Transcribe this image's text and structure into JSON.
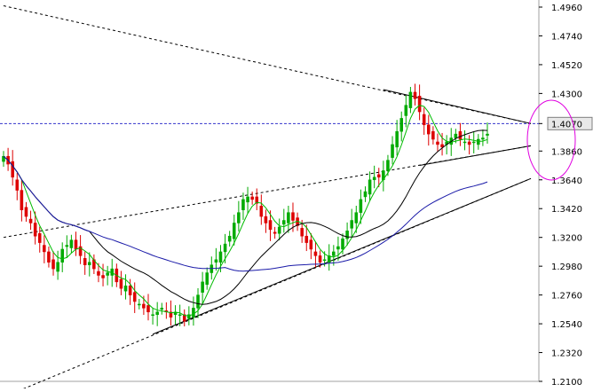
{
  "chart_data": {
    "type": "candlestick",
    "title": "",
    "xlabel": "",
    "ylabel": "",
    "ylim": [
      1.21,
      1.496
    ],
    "y_ticks": [
      "1.4960",
      "1.4740",
      "1.4520",
      "1.4300",
      "1.4070",
      "1.3860",
      "1.3640",
      "1.3420",
      "1.3200",
      "1.2980",
      "1.2760",
      "1.2540",
      "1.2320",
      "1.2100"
    ],
    "current_price": 1.407,
    "current_price_label": "1.4070",
    "bar_count": 108,
    "closes": [
      1.382,
      1.376,
      1.366,
      1.356,
      1.341,
      1.336,
      1.331,
      1.321,
      1.316,
      1.309,
      1.301,
      1.296,
      1.301,
      1.311,
      1.314,
      1.318,
      1.311,
      1.306,
      1.299,
      1.301,
      1.296,
      1.291,
      1.289,
      1.293,
      1.296,
      1.286,
      1.281,
      1.283,
      1.276,
      1.271,
      1.269,
      1.266,
      1.263,
      1.261,
      1.263,
      1.266,
      1.263,
      1.259,
      1.263,
      1.261,
      1.256,
      1.261,
      1.266,
      1.276,
      1.286,
      1.293,
      1.299,
      1.303,
      1.309,
      1.315,
      1.321,
      1.331,
      1.339,
      1.349,
      1.351,
      1.349,
      1.346,
      1.336,
      1.331,
      1.326,
      1.323,
      1.328,
      1.333,
      1.339,
      1.333,
      1.329,
      1.321,
      1.316,
      1.311,
      1.306,
      1.301,
      1.303,
      1.306,
      1.309,
      1.313,
      1.319,
      1.325,
      1.333,
      1.339,
      1.349,
      1.355,
      1.364,
      1.366,
      1.366,
      1.371,
      1.379,
      1.391,
      1.401,
      1.411,
      1.421,
      1.431,
      1.426,
      1.416,
      1.406,
      1.399,
      1.395,
      1.391,
      1.389,
      1.393,
      1.396,
      1.399,
      1.395,
      1.393,
      1.391,
      1.393,
      1.395,
      1.396,
      1.399
    ],
    "series": [
      {
        "type": "ma",
        "color": "#00bb00",
        "period": 5
      },
      {
        "type": "ma",
        "color": "#000000",
        "period": 20
      },
      {
        "type": "ma",
        "color": "#1a1aa8",
        "period": 50
      }
    ],
    "trendlines": [
      {
        "style": "solid",
        "from": [
          33,
          1.246
        ],
        "to": [
          107,
          1.365
        ]
      },
      {
        "style": "solid",
        "from": [
          84,
          1.433
        ],
        "to": [
          107,
          1.407
        ]
      },
      {
        "style": "solid",
        "from": [
          92,
          1.375
        ],
        "to": [
          107,
          1.39
        ]
      },
      {
        "style": "dashed",
        "from": [
          0,
          1.497
        ],
        "to": [
          107,
          1.407
        ]
      },
      {
        "style": "dashed",
        "from": [
          0,
          1.32
        ],
        "to": [
          107,
          1.39
        ]
      },
      {
        "style": "dashed",
        "from": [
          0,
          1.198
        ],
        "to": [
          107,
          1.365
        ]
      }
    ],
    "colors": {
      "bull": "#00aa00",
      "bear": "#dd0000",
      "axis": "#a0a0a0",
      "price_line": "#3333cc",
      "ellipse": "#e000e0"
    },
    "grid": false,
    "legend": "none"
  }
}
